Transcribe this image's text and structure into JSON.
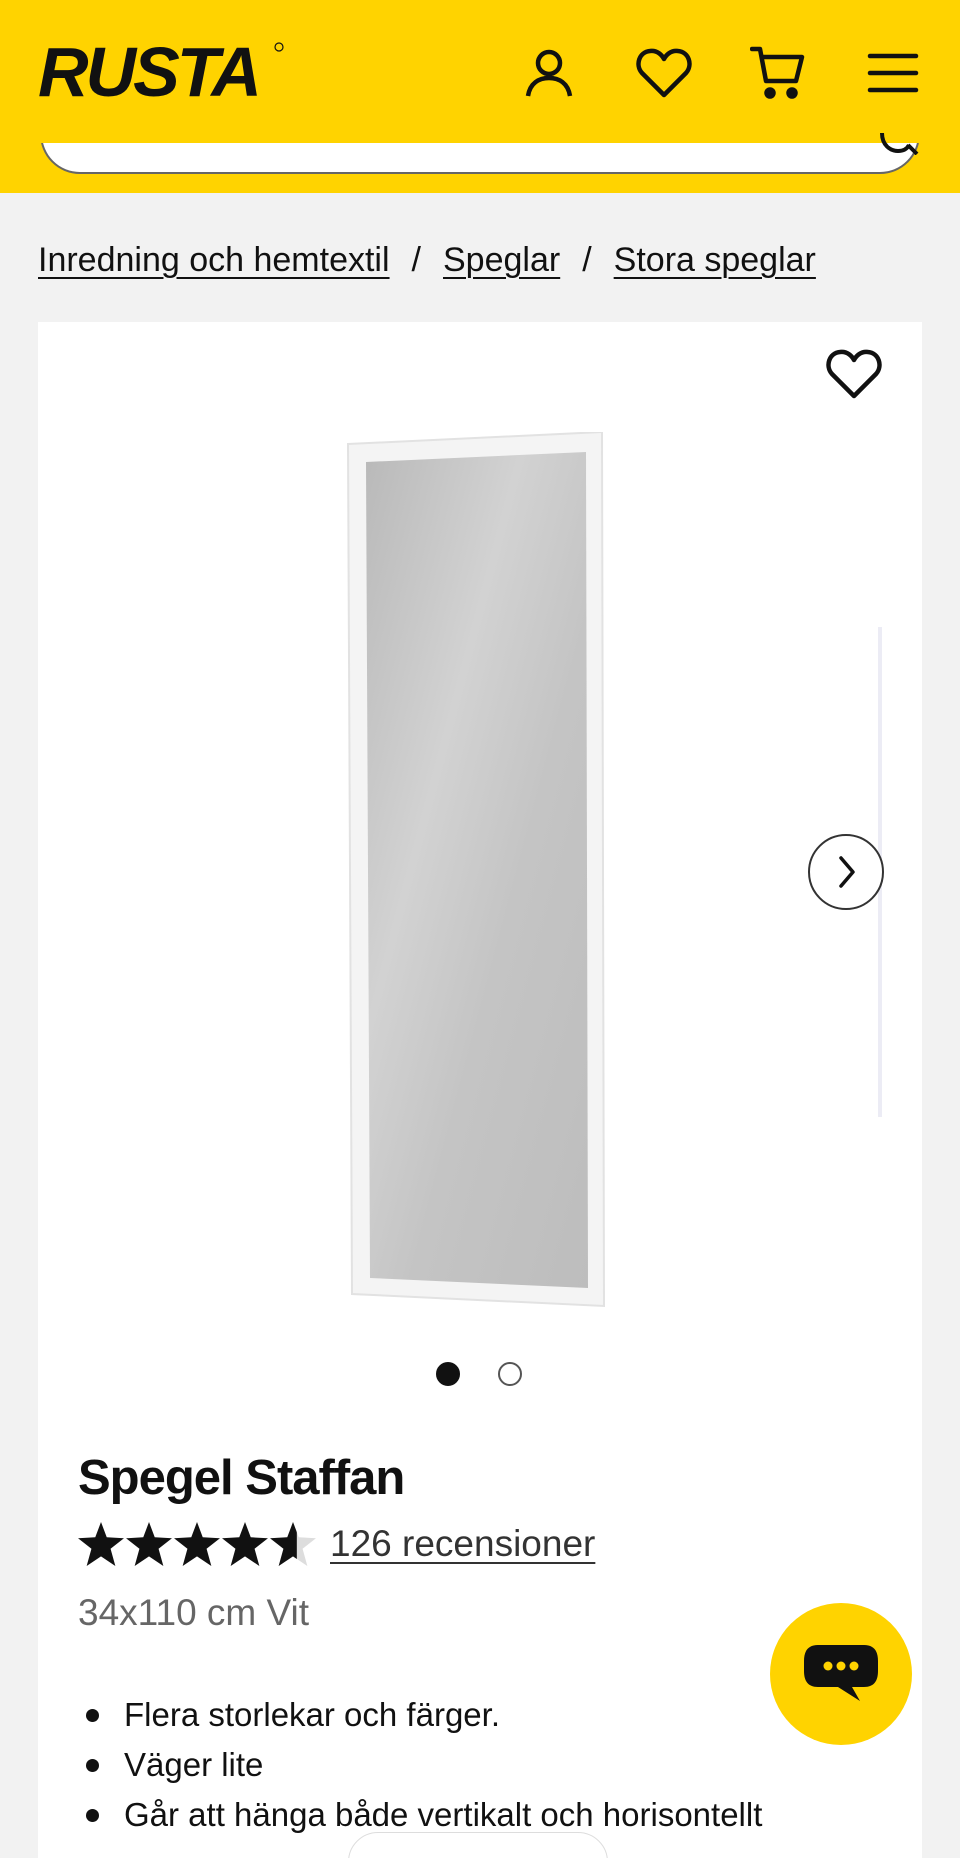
{
  "header": {
    "logo_text": "RUSTA",
    "brand_color": "#ffd300",
    "icons": [
      "user-icon",
      "heart-icon",
      "cart-icon",
      "menu-icon"
    ]
  },
  "search": {
    "icon": "search-icon"
  },
  "breadcrumb": {
    "items": [
      "Inredning och hemtextil",
      "Speglar",
      "Stora speglar"
    ],
    "separator": "/"
  },
  "product": {
    "title": "Spegel Staffan",
    "rating": 4.5,
    "reviews": "126 recensioner",
    "variant": "34x110 cm Vit",
    "bullets": [
      "Flera storlekar och färger.",
      "Väger lite",
      "Går att hänga både vertikalt och horisontellt"
    ],
    "gallery": {
      "current": 1,
      "total": 2
    }
  },
  "chat": {
    "icon": "chat-bubble-icon"
  }
}
